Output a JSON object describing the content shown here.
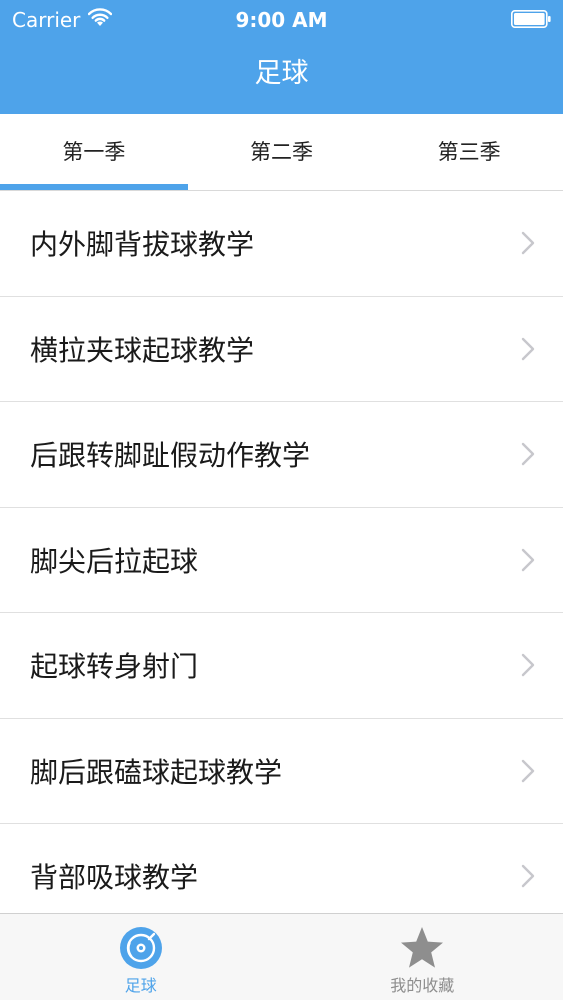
{
  "status_bar": {
    "carrier": "Carrier",
    "time": "9:00 AM"
  },
  "nav": {
    "title": "足球"
  },
  "tabs": [
    {
      "label": "第一季",
      "selected": true
    },
    {
      "label": "第二季",
      "selected": false
    },
    {
      "label": "第三季",
      "selected": false
    }
  ],
  "list": {
    "items": [
      {
        "label": "内外脚背拔球教学"
      },
      {
        "label": "横拉夹球起球教学"
      },
      {
        "label": "后跟转脚趾假动作教学"
      },
      {
        "label": "脚尖后拉起球"
      },
      {
        "label": "起球转身射门"
      },
      {
        "label": "脚后跟磕球起球教学"
      },
      {
        "label": "背部吸球教学"
      }
    ]
  },
  "tabbar": {
    "items": [
      {
        "label": "足球",
        "icon": "disc-icon",
        "selected": true
      },
      {
        "label": "我的收藏",
        "icon": "star-icon",
        "selected": false
      }
    ]
  },
  "colors": {
    "accent": "#4ea3ea",
    "inactive": "#8e8e8e"
  }
}
